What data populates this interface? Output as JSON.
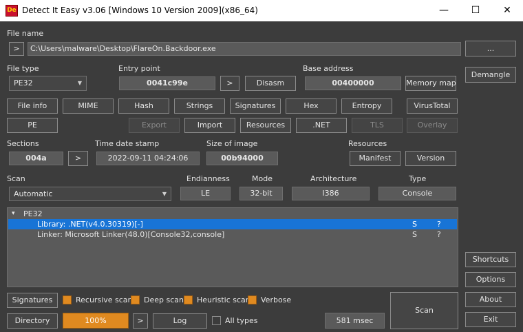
{
  "window": {
    "title": "Detect It Easy v3.06 [Windows 10 Version 2009](x86_64)",
    "icon_text": "De",
    "minimize": "—",
    "maximize": "☐",
    "close": "✕"
  },
  "file": {
    "label": "File name",
    "path": "C:\\Users\\malware\\Desktop\\FlareOn.Backdoor.exe",
    "nav": ">",
    "browse": "..."
  },
  "filetype": {
    "label": "File type",
    "value": "PE32"
  },
  "entry": {
    "label": "Entry point",
    "value": "0041c99e",
    "nav": ">",
    "disasm": "Disasm"
  },
  "base": {
    "label": "Base address",
    "value": "00400000",
    "memmap": "Memory map"
  },
  "demangle": "Demangle",
  "row1": [
    "File info",
    "MIME",
    "Hash",
    "Strings",
    "Signatures",
    "Hex",
    "Entropy",
    "VirusTotal"
  ],
  "row2": {
    "pe": "PE",
    "export": "Export",
    "import": "Import",
    "resources": "Resources",
    "net": ".NET",
    "tls": "TLS",
    "overlay": "Overlay"
  },
  "sections": {
    "label": "Sections",
    "value": "004a",
    "nav": ">"
  },
  "timestamp": {
    "label": "Time date stamp",
    "value": "2022-09-11 04:24:06"
  },
  "size": {
    "label": "Size of image",
    "value": "00b94000"
  },
  "resources": {
    "label": "Resources",
    "manifest": "Manifest",
    "version": "Version"
  },
  "scan": {
    "label": "Scan",
    "value": "Automatic"
  },
  "endianness": {
    "label": "Endianness",
    "value": "LE"
  },
  "mode": {
    "label": "Mode",
    "value": "32-bit"
  },
  "arch": {
    "label": "Architecture",
    "value": "I386"
  },
  "type": {
    "label": "Type",
    "value": "Console"
  },
  "results": {
    "root": "PE32",
    "expander": "▾",
    "items": [
      {
        "text": "Library: .NET(v4.0.30319)[-]",
        "s": "S",
        "q": "?"
      },
      {
        "text": "Linker: Microsoft Linker(48.0)[Console32,console]",
        "s": "S",
        "q": "?"
      }
    ]
  },
  "side": {
    "shortcuts": "Shortcuts",
    "options": "Options",
    "about": "About",
    "exit": "Exit"
  },
  "bottom": {
    "signatures": "Signatures",
    "recursive": "Recursive scan",
    "deep": "Deep scan",
    "heuristic": "Heuristic scan",
    "verbose": "Verbose",
    "directory": "Directory",
    "progress": "100%",
    "progress_value": 1.0,
    "nav": ">",
    "log": "Log",
    "alltypes": "All types",
    "time": "581 msec",
    "scan": "Scan"
  },
  "colors": {
    "accent": "#e08a20",
    "selection": "#1874d6",
    "background": "#3c3c3c"
  }
}
